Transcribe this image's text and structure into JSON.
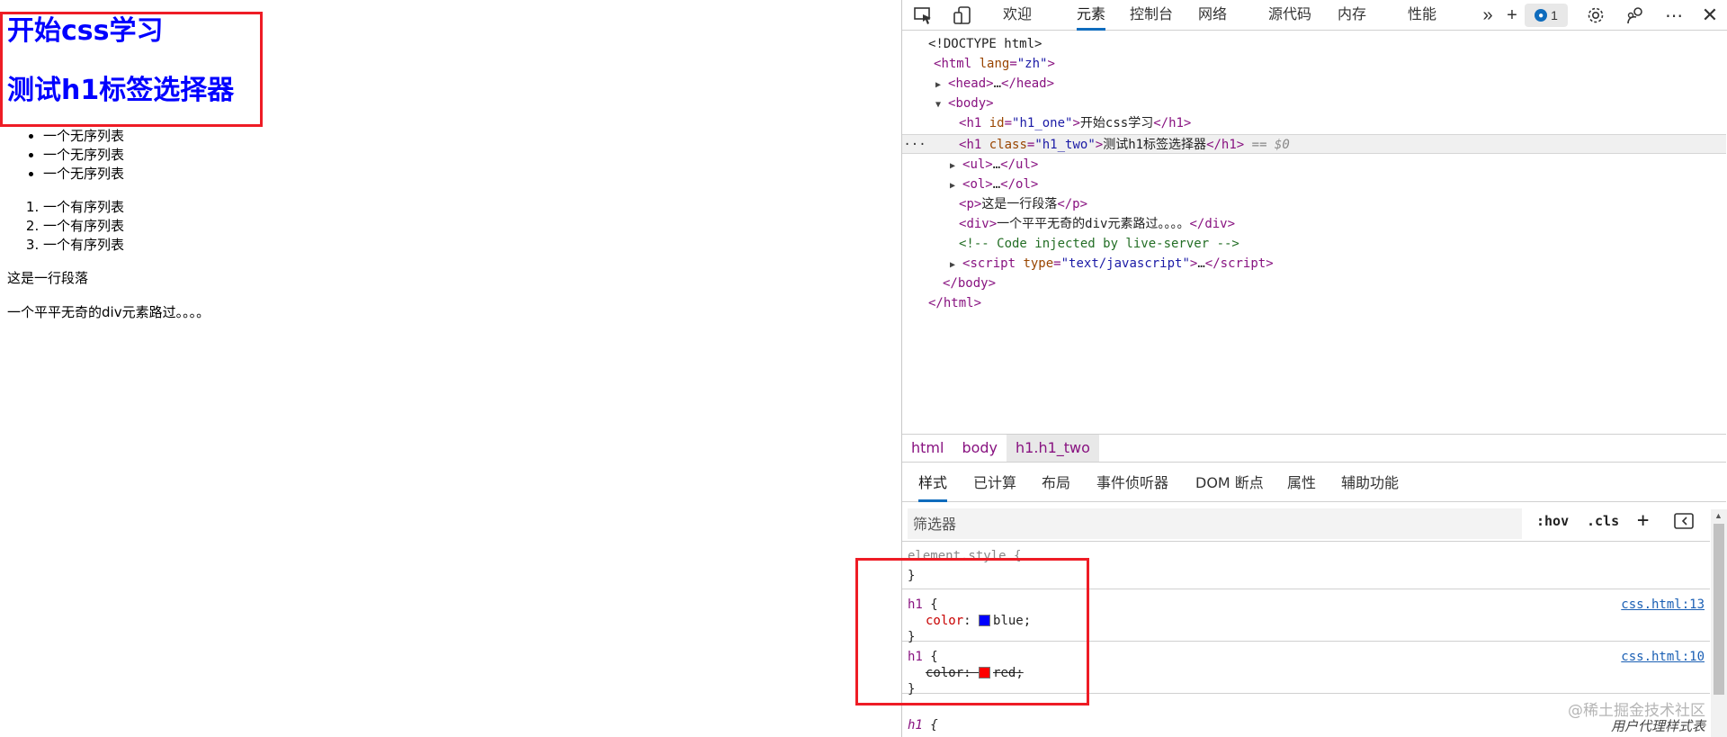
{
  "page": {
    "h1_one": "开始css学习",
    "h1_two": "测试h1标签选择器",
    "ul_items": [
      "一个无序列表",
      "一个无序列表",
      "一个无序列表"
    ],
    "ol_items": [
      "一个有序列表",
      "一个有序列表",
      "一个有序列表"
    ],
    "paragraph": "这是一行段落",
    "div_text": "一个平平无奇的div元素路过。。。。"
  },
  "devtools": {
    "tabs": [
      "欢迎",
      "元素",
      "控制台",
      "网络",
      "源代码",
      "内存",
      "性能"
    ],
    "active_tab": "元素",
    "issues_count": "1",
    "more_tabs": "»",
    "plus": "+",
    "dom": {
      "doctype": "<!DOCTYPE html>",
      "html_open_tag": "html",
      "html_lang_attr": "lang",
      "html_lang_val": "\"zh\"",
      "head": "head",
      "head_ellipsis": "…",
      "body": "body",
      "h1_tag": "h1",
      "h1_one_attr": "id",
      "h1_one_val": "\"h1_one\"",
      "h1_one_text": "开始css学习",
      "h1_two_attr": "class",
      "h1_two_val": "\"h1_two\"",
      "h1_two_text": "测试h1标签选择器",
      "selected_marker": "== $0",
      "ul": "ul",
      "ol": "ol",
      "p": "p",
      "p_text": "这是一行段落",
      "div": "div",
      "div_text": "一个平平无奇的div元素路过。。。。",
      "comment": "<!-- Code injected by live-server -->",
      "script": "script",
      "script_attr": "type",
      "script_val": "\"text/javascript\"",
      "ellipsis": "…"
    },
    "breadcrumbs": [
      "html",
      "body",
      "h1.h1_two"
    ],
    "subtabs": [
      "样式",
      "已计算",
      "布局",
      "事件侦听器",
      "DOM 断点",
      "属性",
      "辅助功能"
    ],
    "filter_placeholder": "筛选器",
    "hov": ":hov",
    "cls": ".cls",
    "rules": {
      "element_style": "element.style {",
      "close": "}",
      "rule1_selector": "h1",
      "rule1_prop": "color",
      "rule1_value": "blue",
      "rule1_swatch": "#0000ff",
      "rule1_source": "css.html:13",
      "rule2_selector": "h1",
      "rule2_prop": "color",
      "rule2_value": "red",
      "rule2_swatch": "#ff0000",
      "rule2_source": "css.html:10",
      "rule3_selector": "h1",
      "open_brace": "{",
      "ua_label": "用户代理样式表"
    },
    "watermark": "@稀土掘金技术社区"
  },
  "colors": {
    "heading": "#0000ff",
    "highlight_box": "#ee1c25",
    "accent": "#0f6cbd"
  }
}
